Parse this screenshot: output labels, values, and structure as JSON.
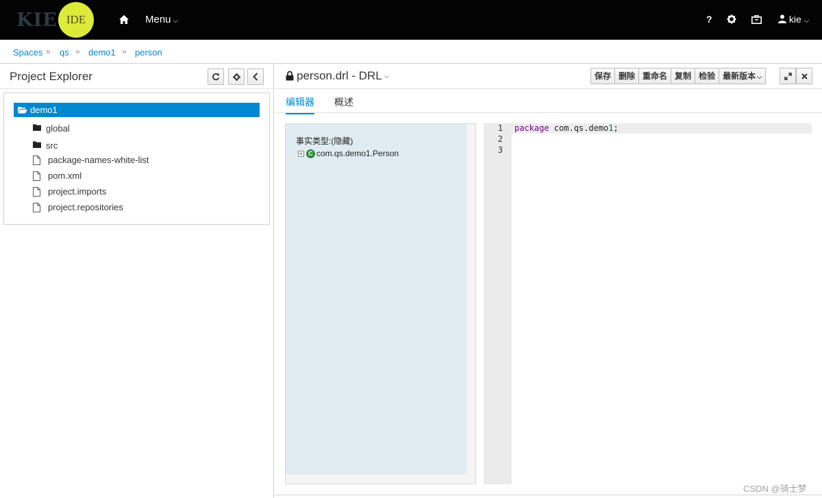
{
  "navbar": {
    "logo_kie": "KIE",
    "logo_ide": "IDE",
    "menu_label": "Menu",
    "help_label": "?",
    "user_label": "kie"
  },
  "breadcrumb": [
    "Spaces",
    "qs",
    "demo1",
    "person"
  ],
  "explorer": {
    "title": "Project Explorer",
    "root": "demo1",
    "folders": [
      "global",
      "src"
    ],
    "files": [
      "package-names-white-list",
      "pom.xml",
      "project.imports",
      "project.repositories"
    ]
  },
  "editor": {
    "title": "person.drl - DRL",
    "toolbar": {
      "save": "保存",
      "delete": "删除",
      "rename": "重命名",
      "copy": "复制",
      "validate": "检验",
      "latest_version": "最新版本"
    },
    "tabs": {
      "editor": "编辑器",
      "overview": "概述"
    },
    "facts_title": "事实类型:(隐藏)",
    "fact_item": "com.qs.demo1.Person",
    "line_numbers": [
      "1",
      "2",
      "3"
    ],
    "code": {
      "keyword": "package",
      "pkg_prefix": " com.qs.demo",
      "pkg_num": "1",
      "pkg_suffix": ";"
    }
  },
  "watermark": "CSDN @骑士梦",
  "colors": {
    "accent": "#0088ce",
    "navbar": "#030303",
    "facts_bg": "#e1ecf2"
  }
}
